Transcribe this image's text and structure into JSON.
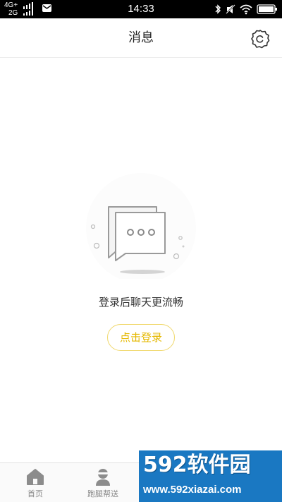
{
  "status_bar": {
    "network_top": "4G+",
    "network_bottom": "2G",
    "time": "14:33"
  },
  "header": {
    "title": "消息",
    "settings_icon": "settings-gear-icon"
  },
  "empty_state": {
    "icon": "chat-bubbles-icon",
    "message": "登录后聊天更流畅",
    "login_button": "点击登录"
  },
  "bottom_nav": {
    "items": [
      {
        "label": "首页",
        "icon": "home-icon"
      },
      {
        "label": "跑腿帮送",
        "icon": "courier-icon"
      }
    ]
  },
  "watermark": {
    "brand": "592软件园",
    "url": "www.592xiazai.com"
  },
  "colors": {
    "accent_yellow": "#e5b800",
    "watermark_blue": "#1a78c2"
  }
}
